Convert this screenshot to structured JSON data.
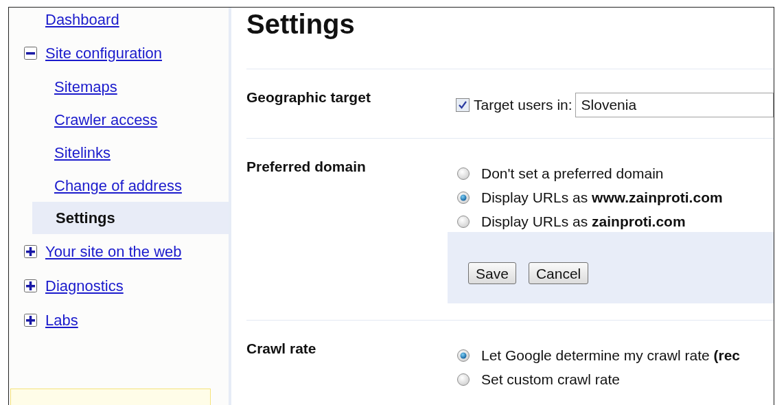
{
  "sidebar": {
    "items": [
      {
        "kind": "link",
        "label": "Dashboard",
        "selected": false
      },
      {
        "kind": "group",
        "label": "Site configuration",
        "expanded": true,
        "selected": false,
        "children": [
          {
            "kind": "link",
            "label": "Sitemaps",
            "selected": false
          },
          {
            "kind": "link",
            "label": "Crawler access",
            "selected": false
          },
          {
            "kind": "link",
            "label": "Sitelinks",
            "selected": false
          },
          {
            "kind": "link",
            "label": "Change of address",
            "selected": false
          },
          {
            "kind": "link",
            "label": "Settings",
            "selected": true
          }
        ]
      },
      {
        "kind": "group",
        "label": "Your site on the web",
        "expanded": false,
        "selected": false
      },
      {
        "kind": "group",
        "label": "Diagnostics",
        "expanded": false,
        "selected": false
      },
      {
        "kind": "group",
        "label": "Labs",
        "expanded": false,
        "selected": false
      }
    ]
  },
  "page_title": "Settings",
  "sections": [
    {
      "kind": "checkbox",
      "label": "Geographic target",
      "checkbox": {
        "label": "Target users in:",
        "checked": true
      },
      "select": {
        "value": "Slovenia"
      }
    },
    {
      "kind": "radios",
      "label": "Preferred domain",
      "options": [
        {
          "label": "Don't set a preferred domain",
          "selected": false
        },
        {
          "label": "Display URLs as **www.zainproti.com**",
          "selected": true
        },
        {
          "label": "Display URLs as **zainproti.com**",
          "selected": false
        }
      ],
      "buttons": [
        "Save",
        "Cancel"
      ]
    },
    {
      "kind": "radios",
      "label": "Crawl rate",
      "options": [
        {
          "label": "Let Google determine my crawl rate **(rec**",
          "selected": true
        },
        {
          "label": "Set custom crawl rate",
          "selected": false
        }
      ]
    }
  ]
}
